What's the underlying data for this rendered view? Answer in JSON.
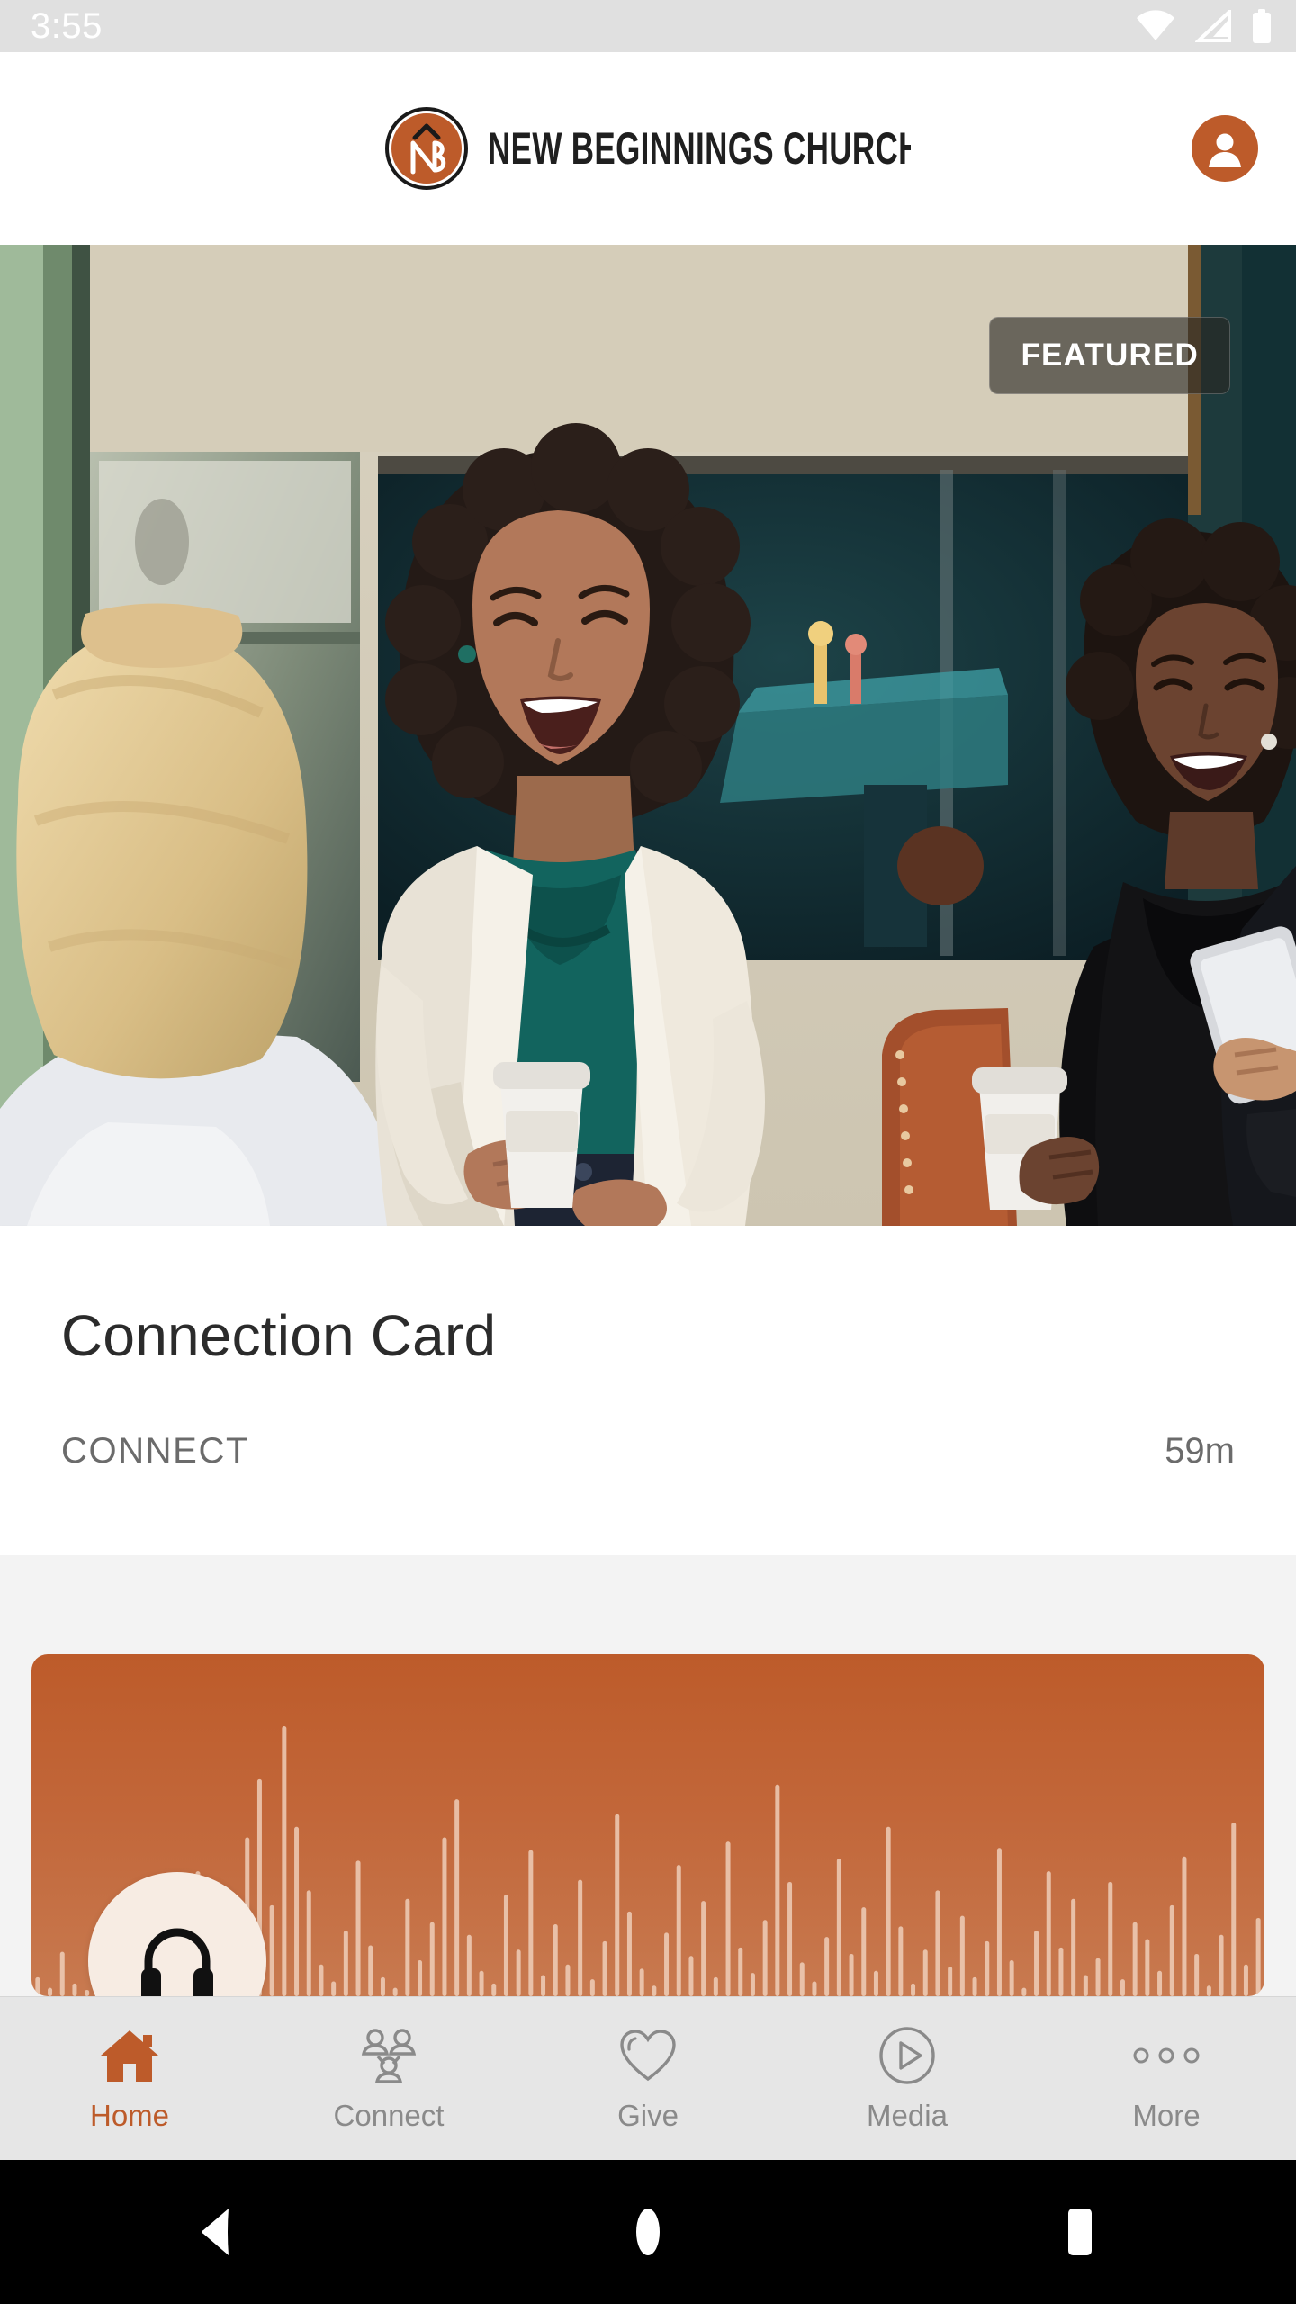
{
  "status_bar": {
    "time": "3:55",
    "icons": [
      "wifi-icon",
      "cellular-signal-icon",
      "battery-icon"
    ]
  },
  "header": {
    "brand_name": "NEW BEGINNINGS CHURCH",
    "logo_monogram": "NB",
    "avatar_icon": "user-avatar-icon"
  },
  "hero": {
    "badge_label": "FEATURED",
    "image_description": "Three women smiling and talking while holding coffee cups in a church lobby"
  },
  "feature_card": {
    "title": "Connection Card",
    "category": "CONNECT",
    "duration": "59m"
  },
  "audio_card": {
    "icon": "headphones-icon",
    "waveform_heights": [
      18,
      8,
      42,
      12,
      6,
      26,
      58,
      14,
      9,
      35,
      96,
      22,
      64,
      118,
      40,
      10,
      74,
      150,
      205,
      86,
      255,
      160,
      100,
      30,
      14,
      62,
      128,
      48,
      18,
      8,
      92,
      34,
      70,
      150,
      186,
      58,
      24,
      12,
      96,
      44,
      138,
      20,
      68,
      30,
      110,
      16,
      52,
      172,
      80,
      26,
      10,
      60,
      124,
      38,
      90,
      18,
      146,
      46,
      22,
      72,
      200,
      108,
      32,
      14,
      56,
      130,
      40,
      84,
      24,
      160,
      66,
      12,
      44,
      100,
      28,
      76,
      18,
      52,
      140,
      34,
      8,
      62,
      118,
      46,
      92,
      20,
      36,
      108,
      16,
      70,
      54,
      24,
      86,
      132,
      40,
      10,
      58,
      164,
      30,
      74
    ]
  },
  "tab_bar": {
    "items": [
      {
        "label": "Home",
        "icon": "home-icon",
        "active": true
      },
      {
        "label": "Connect",
        "icon": "people-icon",
        "active": false
      },
      {
        "label": "Give",
        "icon": "heart-icon",
        "active": false
      },
      {
        "label": "Media",
        "icon": "play-circle-icon",
        "active": false
      },
      {
        "label": "More",
        "icon": "more-dots-icon",
        "active": false
      }
    ]
  },
  "android_nav": {
    "back_label": "back-button",
    "home_label": "home-button",
    "recents_label": "recent-apps-button"
  },
  "colors": {
    "brand_orange": "#bd5b2a",
    "status_bar_bg": "#e0e0e0",
    "tab_bar_bg": "#e6e6e6",
    "tab_inactive": "#8a8a8a",
    "page_bg": "#f3f3f3",
    "text_primary": "#2b2b2b",
    "text_secondary": "#6b6b6b"
  }
}
